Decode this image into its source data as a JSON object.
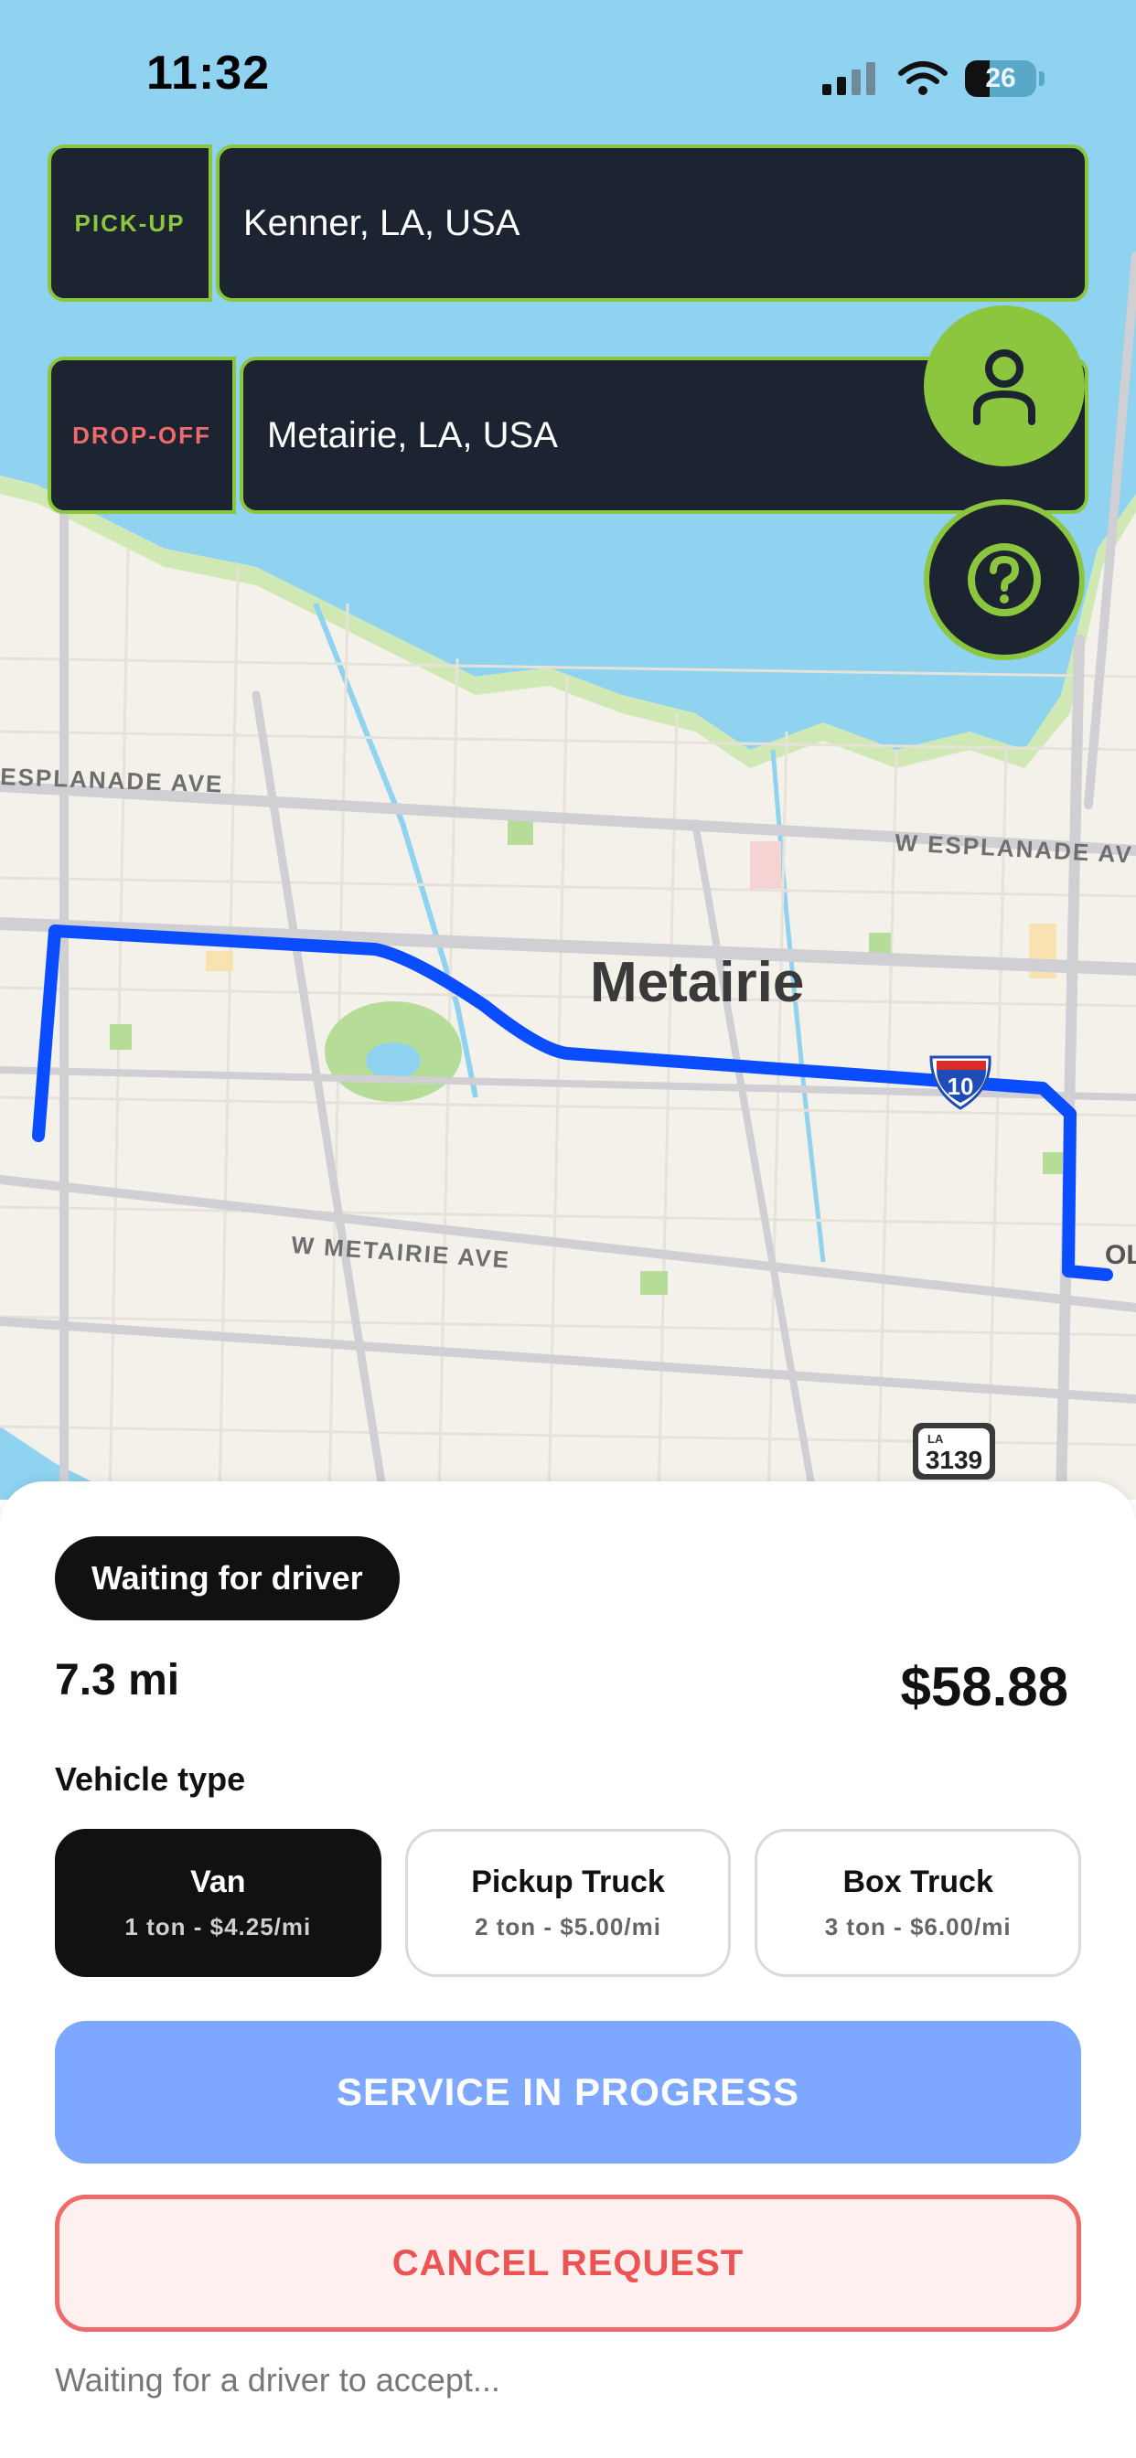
{
  "status_bar": {
    "time": "11:32",
    "battery_level": "26",
    "signal_icon": "cellular-signal-icon",
    "wifi_icon": "wifi-icon"
  },
  "route": {
    "pickup_tag": "PICK-UP",
    "pickup_value": "Kenner, LA, USA",
    "dropoff_tag": "DROP-OFF",
    "dropoff_value": "Metairie, LA, USA"
  },
  "map": {
    "city_label": "Metairie",
    "streets": [
      "ESPLANADE AVE",
      "W ESPLANADE AV",
      "W METAIRIE AVE",
      "OL"
    ],
    "shields": {
      "interstate": "10",
      "state_prefix": "LA",
      "state": "3139"
    }
  },
  "actions": {
    "profile_icon": "person-icon",
    "help_icon": "question-circle-icon"
  },
  "trip": {
    "status": "Waiting for driver",
    "distance": "7.3 mi",
    "price": "$58.88",
    "vehicle_type_label": "Vehicle type",
    "vehicles": [
      {
        "name": "Van",
        "detail": "1 ton - $4.25/mi",
        "selected": true
      },
      {
        "name": "Pickup Truck",
        "detail": "2 ton - $5.00/mi",
        "selected": false
      },
      {
        "name": "Box Truck",
        "detail": "3 ton - $6.00/mi",
        "selected": false
      }
    ],
    "primary_button": "SERVICE IN PROGRESS",
    "cancel_button": "CANCEL REQUEST",
    "footer_note": "Waiting for a driver to accept..."
  },
  "colors": {
    "accent_green": "#8cc63f",
    "field_bg": "#1b2430",
    "route_blue": "#0a4cff",
    "primary_button": "#7ea8ff",
    "cancel_red": "#ee5353",
    "water": "#8fd3f1"
  }
}
